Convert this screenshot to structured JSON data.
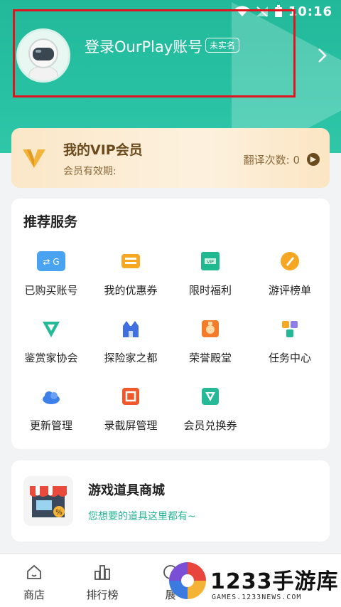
{
  "status_bar": {
    "time": "10:16"
  },
  "profile": {
    "login_label": "登录OurPlay账号",
    "badge": "未实名",
    "avatar_icon": "astronaut-avatar-icon"
  },
  "vip": {
    "title": "我的VIP会员",
    "subtitle": "会员有效期:",
    "count_label": "翻译次数: 0",
    "colors": {
      "bg": "#fbe7c8",
      "text": "#6b4a1d"
    }
  },
  "services": {
    "title": "推荐服务",
    "items": [
      {
        "label": "已购买账号",
        "icon": "purchased-account-icon"
      },
      {
        "label": "我的优惠券",
        "icon": "coupon-icon"
      },
      {
        "label": "限时福利",
        "icon": "limited-welfare-icon"
      },
      {
        "label": "游评榜单",
        "icon": "review-ranking-icon"
      },
      {
        "label": "鉴赏家协会",
        "icon": "connoisseur-icon"
      },
      {
        "label": "探险家之都",
        "icon": "explorer-castle-icon"
      },
      {
        "label": "荣誉殿堂",
        "icon": "honor-hall-icon"
      },
      {
        "label": "任务中心",
        "icon": "task-center-icon"
      },
      {
        "label": "更新管理",
        "icon": "cloud-update-icon"
      },
      {
        "label": "录截屏管理",
        "icon": "screen-record-icon"
      },
      {
        "label": "会员兑换券",
        "icon": "vip-voucher-icon"
      }
    ]
  },
  "shop": {
    "title": "游戏道具商城",
    "subtitle": "您想要的道具这里都有~",
    "icon": "store-icon"
  },
  "bottom_nav": {
    "items": [
      {
        "label": "商店",
        "icon": "home-store-icon"
      },
      {
        "label": "排行榜",
        "icon": "ranking-icon"
      },
      {
        "label": "展",
        "icon": "partial-nav-icon"
      }
    ]
  },
  "watermark": {
    "text": "1233手游库",
    "sub": "GAMES.1233NEWS.COM"
  },
  "colors": {
    "accent": "#22b99a",
    "highlight_box": "#e0141e"
  }
}
